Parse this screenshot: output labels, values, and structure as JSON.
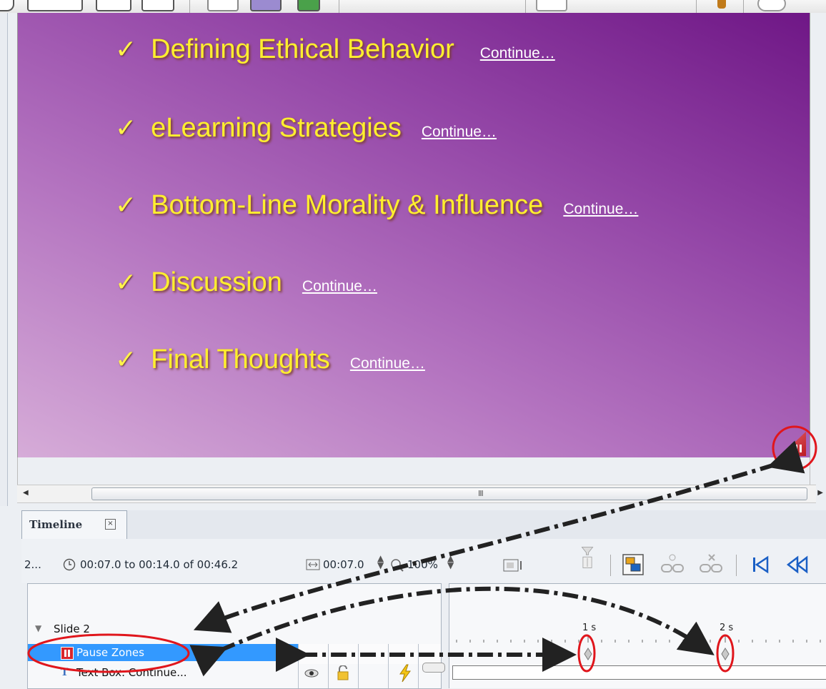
{
  "slide": {
    "bullets": [
      {
        "text": "Defining Ethical Behavior",
        "link": "Continue…"
      },
      {
        "text": "eLearning Strategies",
        "link": "Continue…"
      },
      {
        "text": "Bottom-Line Morality & Influence",
        "link": "Continue…"
      },
      {
        "text": "Discussion",
        "link": "Continue…"
      },
      {
        "text": "Final Thoughts",
        "link": "Continue…"
      }
    ],
    "check_glyph": "✓",
    "colors": {
      "bullet_text": "#ffef2e",
      "bg_dark": "#6f1786",
      "bg_light": "#d6acd8"
    }
  },
  "scrollbar": {
    "grip": "III"
  },
  "timeline": {
    "tab_label": "Timeline",
    "close_glyph": "☒",
    "toolbar": {
      "slide_num": "2...",
      "time_range": "00:07.0 to 00:14.0 of 00:46.2",
      "duration": "00:07.0",
      "zoom": "100%"
    },
    "rows": {
      "slide": "Slide 2",
      "pause": "Pause Zones",
      "textbox": "Text Box: Continue..."
    },
    "ruler": {
      "mark1": "1 s",
      "mark2": "2 s"
    },
    "highlight_color": "#3399ff",
    "annotation_color": "#e0161c"
  }
}
